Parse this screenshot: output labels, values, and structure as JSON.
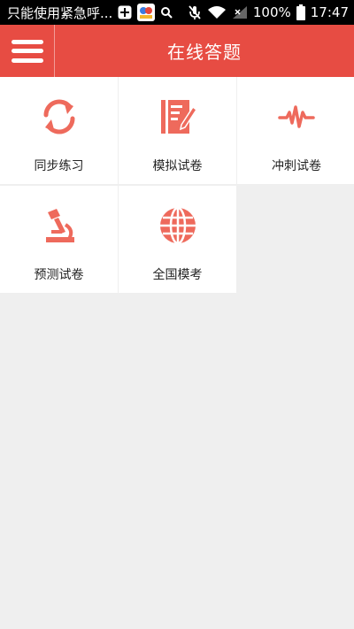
{
  "status_bar": {
    "notification_text": "只能使用紧急呼...",
    "battery_percent": "100%",
    "time": "17:47"
  },
  "app_bar": {
    "title": "在线答题",
    "accent_color": "#e74c43"
  },
  "tiles": [
    {
      "label": "同步练习",
      "icon": "sync-icon"
    },
    {
      "label": "模拟试卷",
      "icon": "exam-paper-icon"
    },
    {
      "label": "冲刺试卷",
      "icon": "pulse-icon"
    },
    {
      "label": "预测试卷",
      "icon": "microscope-icon"
    },
    {
      "label": "全国模考",
      "icon": "globe-icon"
    }
  ],
  "icon_color": "#ee6a5c",
  "background_color": "#efefef"
}
